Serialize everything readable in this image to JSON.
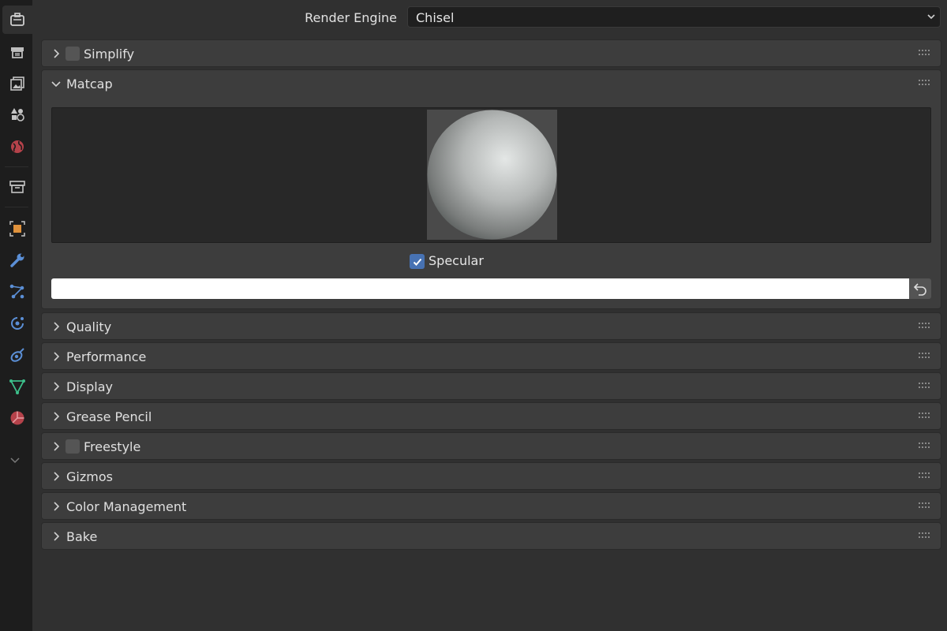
{
  "sidebar": {
    "tabs": [
      {
        "name": "tool-tab",
        "icon": "tool-icon",
        "active": true
      },
      {
        "name": "render-tab",
        "icon": "render-icon"
      },
      {
        "name": "output-tab",
        "icon": "output-icon"
      },
      {
        "name": "view-layer-tab",
        "icon": "view-layer-icon"
      },
      {
        "name": "scene-tab",
        "icon": "scene-icon"
      },
      {
        "name": "world-tab",
        "icon": "world-icon"
      },
      {
        "name": "collection-tab",
        "icon": "collection-icon"
      },
      {
        "name": "object-tab",
        "icon": "object-icon"
      },
      {
        "name": "modifiers-tab",
        "icon": "wrench-icon"
      },
      {
        "name": "particles-tab",
        "icon": "particles-icon"
      },
      {
        "name": "physics-tab",
        "icon": "physics-icon"
      },
      {
        "name": "constraints-tab",
        "icon": "constraints-icon"
      },
      {
        "name": "data-tab",
        "icon": "mesh-data-icon"
      },
      {
        "name": "material-tab",
        "icon": "material-icon"
      }
    ],
    "more_icon": "chevron-down-icon"
  },
  "header": {
    "render_engine_label": "Render Engine",
    "render_engine_value": "Chisel"
  },
  "panels": {
    "simplify": {
      "title": "Simplify",
      "has_checkbox": true,
      "checked": false,
      "expanded": false
    },
    "matcap": {
      "title": "Matcap",
      "expanded": true,
      "specular_label": "Specular",
      "specular_checked": true,
      "path_value": ""
    },
    "quality": {
      "title": "Quality"
    },
    "performance": {
      "title": "Performance"
    },
    "display": {
      "title": "Display"
    },
    "grease_pencil": {
      "title": "Grease Pencil"
    },
    "freestyle": {
      "title": "Freestyle",
      "has_checkbox": true,
      "checked": false
    },
    "gizmos": {
      "title": "Gizmos"
    },
    "color_management": {
      "title": "Color Management"
    },
    "bake": {
      "title": "Bake"
    }
  },
  "colors": {
    "accent": "#4772b3",
    "background": "#303030",
    "panel": "#3d3d3d",
    "sidebar": "#1d1d1d"
  }
}
